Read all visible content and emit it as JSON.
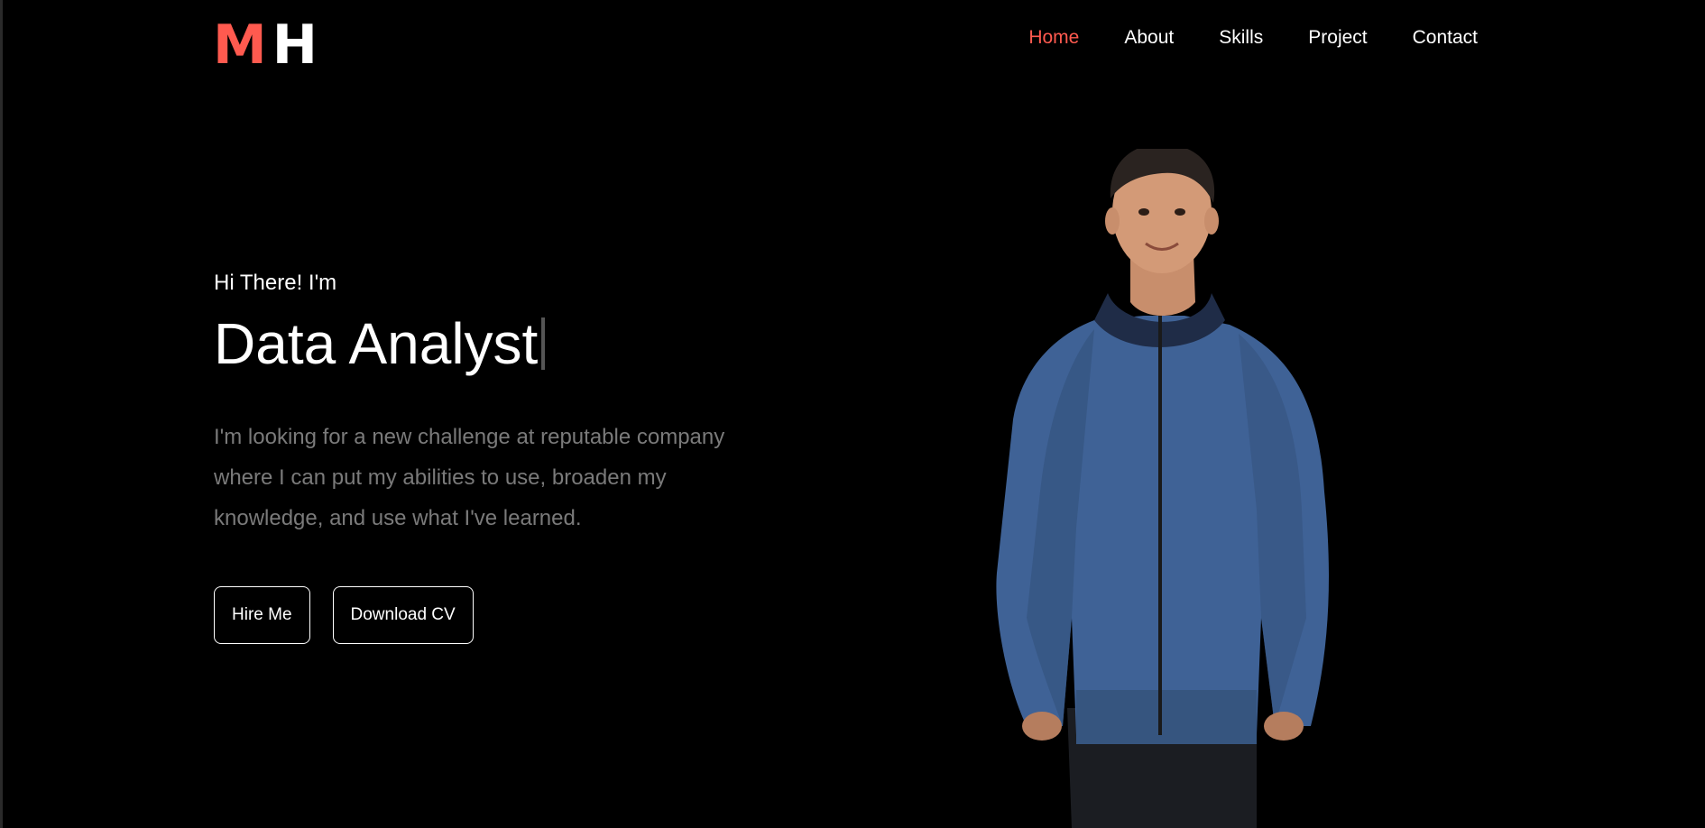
{
  "logo": {
    "first": "M",
    "second": "H"
  },
  "nav": {
    "items": [
      "Home",
      "About",
      "Skills",
      "Project",
      "Contact"
    ],
    "active": "Home"
  },
  "hero": {
    "greeting": "Hi There! I'm",
    "role": "Data Analyst",
    "bio": "I'm looking for a new challenge at reputable company where I can put my abilities to use, broaden my knowledge, and use what I've learned.",
    "hire_label": "Hire Me",
    "download_label": "Download CV"
  },
  "colors": {
    "background": "#000000",
    "accent": "#ff5a4f",
    "text": "#ffffff",
    "muted": "#7a7a7a"
  }
}
